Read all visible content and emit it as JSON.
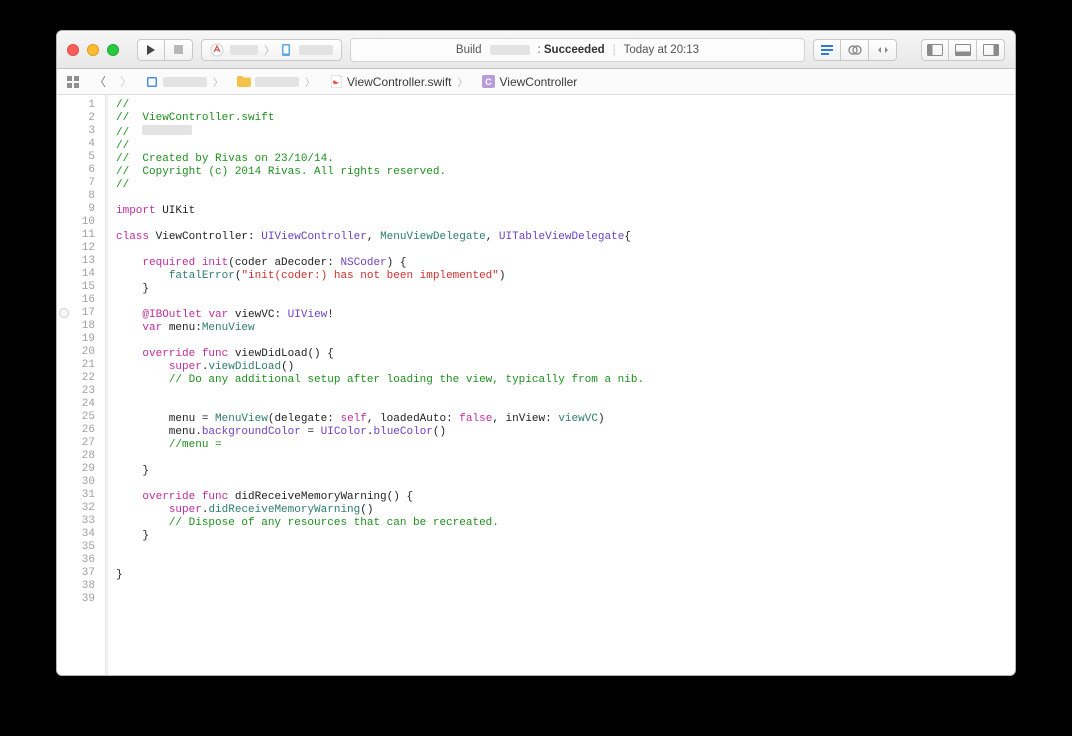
{
  "toolbar": {
    "status_prefix": "Build",
    "status_colon": ": ",
    "status_result": "Succeeded",
    "status_time": "Today at 20:13"
  },
  "jumpbar": {
    "file": "ViewController.swift",
    "symbol": "ViewController"
  },
  "code": {
    "max_line": 39,
    "breakpoint_line": 17,
    "lines": [
      {
        "n": 1,
        "seg": [
          {
            "t": "//",
            "cls": "c-comment"
          }
        ]
      },
      {
        "n": 2,
        "seg": [
          {
            "t": "//  ViewController.swift",
            "cls": "c-comment"
          }
        ]
      },
      {
        "n": 3,
        "seg": [
          {
            "t": "//  ",
            "cls": "c-comment"
          },
          {
            "ph": 50
          }
        ]
      },
      {
        "n": 4,
        "seg": [
          {
            "t": "//",
            "cls": "c-comment"
          }
        ]
      },
      {
        "n": 5,
        "seg": [
          {
            "t": "//  Created by Rivas on 23/10/14.",
            "cls": "c-comment"
          }
        ]
      },
      {
        "n": 6,
        "seg": [
          {
            "t": "//  Copyright (c) 2014 Rivas. All rights reserved.",
            "cls": "c-comment"
          }
        ]
      },
      {
        "n": 7,
        "seg": [
          {
            "t": "//",
            "cls": "c-comment"
          }
        ]
      },
      {
        "n": 8,
        "seg": []
      },
      {
        "n": 9,
        "seg": [
          {
            "t": "import",
            "cls": "c-keyword"
          },
          {
            "t": " UIKit"
          }
        ]
      },
      {
        "n": 10,
        "seg": []
      },
      {
        "n": 11,
        "seg": [
          {
            "t": "class",
            "cls": "c-keyword"
          },
          {
            "t": " ViewController: "
          },
          {
            "t": "UIViewController",
            "cls": "c-typesys"
          },
          {
            "t": ", "
          },
          {
            "t": "MenuViewDelegate",
            "cls": "c-typeuser"
          },
          {
            "t": ", "
          },
          {
            "t": "UITableViewDelegate",
            "cls": "c-typesys"
          },
          {
            "t": "{"
          }
        ]
      },
      {
        "n": 12,
        "seg": []
      },
      {
        "n": 13,
        "seg": [
          {
            "t": "    "
          },
          {
            "t": "required",
            "cls": "c-keyword"
          },
          {
            "t": " "
          },
          {
            "t": "init",
            "cls": "c-keyword"
          },
          {
            "t": "(coder aDecoder: "
          },
          {
            "t": "NSCoder",
            "cls": "c-typesys"
          },
          {
            "t": ") {"
          }
        ]
      },
      {
        "n": 14,
        "seg": [
          {
            "t": "        "
          },
          {
            "t": "fatalError",
            "cls": "c-func"
          },
          {
            "t": "("
          },
          {
            "t": "\"init(coder:) has not been implemented\"",
            "cls": "c-string"
          },
          {
            "t": ")"
          }
        ]
      },
      {
        "n": 15,
        "seg": [
          {
            "t": "    }"
          }
        ]
      },
      {
        "n": 16,
        "seg": []
      },
      {
        "n": 17,
        "seg": [
          {
            "t": "    "
          },
          {
            "t": "@IBOutlet",
            "cls": "c-attr"
          },
          {
            "t": " "
          },
          {
            "t": "var",
            "cls": "c-keyword"
          },
          {
            "t": " viewVC: "
          },
          {
            "t": "UIView",
            "cls": "c-typesys"
          },
          {
            "t": "!"
          }
        ]
      },
      {
        "n": 18,
        "seg": [
          {
            "t": "    "
          },
          {
            "t": "var",
            "cls": "c-keyword"
          },
          {
            "t": " menu:"
          },
          {
            "t": "MenuView",
            "cls": "c-typeuser"
          }
        ]
      },
      {
        "n": 19,
        "seg": []
      },
      {
        "n": 20,
        "seg": [
          {
            "t": "    "
          },
          {
            "t": "override",
            "cls": "c-keyword"
          },
          {
            "t": " "
          },
          {
            "t": "func",
            "cls": "c-keyword"
          },
          {
            "t": " viewDidLoad() {"
          }
        ]
      },
      {
        "n": 21,
        "seg": [
          {
            "t": "        "
          },
          {
            "t": "super",
            "cls": "c-keyword"
          },
          {
            "t": "."
          },
          {
            "t": "viewDidLoad",
            "cls": "c-func"
          },
          {
            "t": "()"
          }
        ]
      },
      {
        "n": 22,
        "seg": [
          {
            "t": "        "
          },
          {
            "t": "// Do any additional setup after loading the view, typically from a nib.",
            "cls": "c-comment"
          }
        ]
      },
      {
        "n": 23,
        "seg": []
      },
      {
        "n": 24,
        "seg": []
      },
      {
        "n": 25,
        "seg": [
          {
            "t": "        menu = "
          },
          {
            "t": "MenuView",
            "cls": "c-typeuser"
          },
          {
            "t": "(delegate: "
          },
          {
            "t": "self",
            "cls": "c-keyword"
          },
          {
            "t": ", loadedAuto: "
          },
          {
            "t": "false",
            "cls": "c-keyword"
          },
          {
            "t": ", inView: "
          },
          {
            "t": "viewVC",
            "cls": "c-func"
          },
          {
            "t": ")"
          }
        ]
      },
      {
        "n": 26,
        "seg": [
          {
            "t": "        menu."
          },
          {
            "t": "backgroundColor",
            "cls": "c-typesys"
          },
          {
            "t": " = "
          },
          {
            "t": "UIColor",
            "cls": "c-typesys"
          },
          {
            "t": "."
          },
          {
            "t": "blueColor",
            "cls": "c-typesys"
          },
          {
            "t": "()"
          }
        ]
      },
      {
        "n": 27,
        "seg": [
          {
            "t": "        "
          },
          {
            "t": "//menu = ",
            "cls": "c-comment"
          }
        ]
      },
      {
        "n": 28,
        "seg": []
      },
      {
        "n": 29,
        "seg": [
          {
            "t": "    }"
          }
        ]
      },
      {
        "n": 30,
        "seg": []
      },
      {
        "n": 31,
        "seg": [
          {
            "t": "    "
          },
          {
            "t": "override",
            "cls": "c-keyword"
          },
          {
            "t": " "
          },
          {
            "t": "func",
            "cls": "c-keyword"
          },
          {
            "t": " didReceiveMemoryWarning() {"
          }
        ]
      },
      {
        "n": 32,
        "seg": [
          {
            "t": "        "
          },
          {
            "t": "super",
            "cls": "c-keyword"
          },
          {
            "t": "."
          },
          {
            "t": "didReceiveMemoryWarning",
            "cls": "c-func"
          },
          {
            "t": "()"
          }
        ]
      },
      {
        "n": 33,
        "seg": [
          {
            "t": "        "
          },
          {
            "t": "// Dispose of any resources that can be recreated.",
            "cls": "c-comment"
          }
        ]
      },
      {
        "n": 34,
        "seg": [
          {
            "t": "    }"
          }
        ]
      },
      {
        "n": 35,
        "seg": []
      },
      {
        "n": 36,
        "seg": []
      },
      {
        "n": 37,
        "seg": [
          {
            "t": "}"
          }
        ]
      },
      {
        "n": 38,
        "seg": []
      },
      {
        "n": 39,
        "seg": []
      }
    ]
  }
}
